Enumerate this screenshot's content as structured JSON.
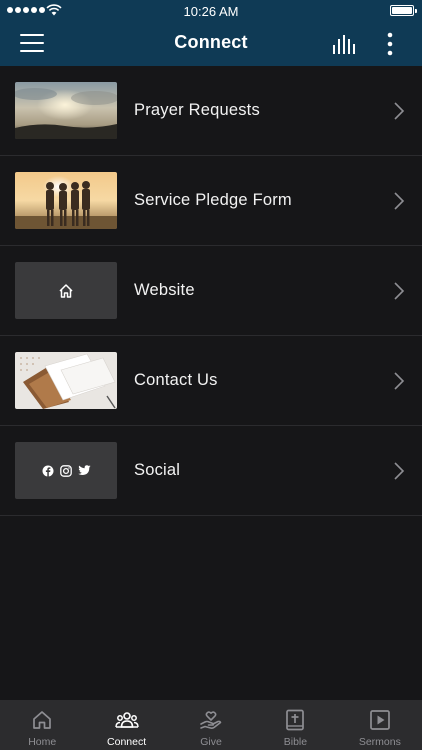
{
  "status_bar": {
    "time": "10:26 AM"
  },
  "header": {
    "title": "Connect",
    "background": "#0f3a55"
  },
  "list_items": [
    {
      "label": "Prayer Requests",
      "thumbnail": "sunset-sky-photo"
    },
    {
      "label": "Service Pledge Form",
      "thumbnail": "group-embrace-photo"
    },
    {
      "label": "Website",
      "thumbnail": "home-icon"
    },
    {
      "label": "Contact Us",
      "thumbnail": "stationery-photo"
    },
    {
      "label": "Social",
      "thumbnail": "facebook-instagram-twitter-icons"
    }
  ],
  "tabbar": {
    "tabs": [
      {
        "label": "Home",
        "icon": "home-icon",
        "active": false
      },
      {
        "label": "Connect",
        "icon": "people-icon",
        "active": true
      },
      {
        "label": "Give",
        "icon": "giving-hand-icon",
        "active": false
      },
      {
        "label": "Bible",
        "icon": "bible-icon",
        "active": false
      },
      {
        "label": "Sermons",
        "icon": "play-icon",
        "active": false
      }
    ]
  },
  "colors": {
    "background": "#161618",
    "tabbar": "#2c2c2e",
    "inactive_tab": "#8e8e93",
    "divider": "#2b2b2e"
  }
}
